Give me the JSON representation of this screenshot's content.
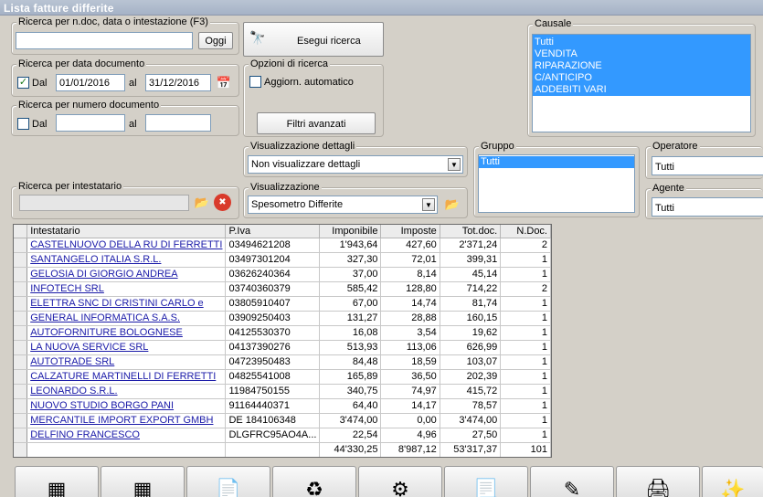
{
  "window": {
    "title": "Lista fatture differite"
  },
  "search_text": {
    "legend": "Ricerca per n.doc, data o intestazione (F3)",
    "value": "",
    "today_button": "Oggi"
  },
  "execute": {
    "label": "Esegui ricerca"
  },
  "date_search": {
    "legend": "Ricerca per data documento",
    "checked": true,
    "from_label": "Dal",
    "from_value": "01/01/2016",
    "to_label": "al",
    "to_value": "31/12/2016"
  },
  "search_options": {
    "legend": "Opzioni di ricerca",
    "auto_update_label": "Aggiorn. automatico",
    "auto_update_checked": false,
    "advanced_filters": "Filtri avanzati"
  },
  "number_search": {
    "legend": "Ricerca per numero documento",
    "checked": false,
    "from_label": "Dal",
    "from_value": "",
    "to_label": "al",
    "to_value": ""
  },
  "causale": {
    "legend": "Causale",
    "items": [
      "Tutti",
      "VENDITA",
      "RIPARAZIONE",
      "C/ANTICIPO",
      "ADDEBITI VARI"
    ]
  },
  "details_view": {
    "legend": "Visualizzazione dettagli",
    "selected": "Non visualizzare dettagli"
  },
  "gruppo": {
    "legend": "Gruppo",
    "items": [
      "Tutti"
    ]
  },
  "operatore": {
    "legend": "Operatore",
    "selected": "Tutti"
  },
  "intestatario_search": {
    "legend": "Ricerca per intestatario",
    "value": ""
  },
  "visualizzazione": {
    "legend": "Visualizzazione",
    "selected": "Spesometro Differite"
  },
  "agente": {
    "legend": "Agente",
    "selected": "Tutti"
  },
  "table": {
    "columns": [
      "Intestatario",
      "P.Iva",
      "Imponibile",
      "Imposte",
      "Tot.doc.",
      "N.Doc."
    ],
    "rows": [
      {
        "name": "CASTELNUOVO DELLA RU DI FERRETTI",
        "piva": "03494621208",
        "imponibile": "1'943,64",
        "imposte": "427,60",
        "tot": "2'371,24",
        "ndoc": "2"
      },
      {
        "name": "SANTANGELO ITALIA S.R.L.",
        "piva": "03497301204",
        "imponibile": "327,30",
        "imposte": "72,01",
        "tot": "399,31",
        "ndoc": "1"
      },
      {
        "name": "GELOSIA DI GIORGIO ANDREA",
        "piva": "03626240364",
        "imponibile": "37,00",
        "imposte": "8,14",
        "tot": "45,14",
        "ndoc": "1"
      },
      {
        "name": "INFOTECH SRL",
        "piva": "03740360379",
        "imponibile": "585,42",
        "imposte": "128,80",
        "tot": "714,22",
        "ndoc": "2"
      },
      {
        "name": "ELETTRA SNC DI CRISTINI CARLO e",
        "piva": "03805910407",
        "imponibile": "67,00",
        "imposte": "14,74",
        "tot": "81,74",
        "ndoc": "1"
      },
      {
        "name": "GENERAL INFORMATICA S.A.S.",
        "piva": "03909250403",
        "imponibile": "131,27",
        "imposte": "28,88",
        "tot": "160,15",
        "ndoc": "1"
      },
      {
        "name": "AUTOFORNITURE BOLOGNESE",
        "piva": "04125530370",
        "imponibile": "16,08",
        "imposte": "3,54",
        "tot": "19,62",
        "ndoc": "1"
      },
      {
        "name": "LA NUOVA SERVICE SRL",
        "piva": "04137390276",
        "imponibile": "513,93",
        "imposte": "113,06",
        "tot": "626,99",
        "ndoc": "1"
      },
      {
        "name": "AUTOTRADE SRL",
        "piva": "04723950483",
        "imponibile": "84,48",
        "imposte": "18,59",
        "tot": "103,07",
        "ndoc": "1"
      },
      {
        "name": "CALZATURE MARTINELLI DI FERRETTI",
        "piva": "04825541008",
        "imponibile": "165,89",
        "imposte": "36,50",
        "tot": "202,39",
        "ndoc": "1"
      },
      {
        "name": "LEONARDO S.R.L.",
        "piva": "11984750155",
        "imponibile": "340,75",
        "imposte": "74,97",
        "tot": "415,72",
        "ndoc": "1"
      },
      {
        "name": "NUOVO STUDIO BORGO PANI",
        "piva": "91164440371",
        "imponibile": "64,40",
        "imposte": "14,17",
        "tot": "78,57",
        "ndoc": "1"
      },
      {
        "name": "MERCANTILE IMPORT EXPORT GMBH",
        "piva": "DE 184106348",
        "imponibile": "3'474,00",
        "imposte": "0,00",
        "tot": "3'474,00",
        "ndoc": "1"
      },
      {
        "name": "DELFINO FRANCESCO",
        "piva": "DLGFRC95AO4A...",
        "imponibile": "22,54",
        "imposte": "4,96",
        "tot": "27,50",
        "ndoc": "1"
      }
    ],
    "totals": {
      "imponibile": "44'330,25",
      "imposte": "8'987,12",
      "tot": "53'317,37",
      "ndoc": "101"
    }
  },
  "icons": {
    "binoculars": "🔭",
    "folder": "📂",
    "clear": "✖",
    "calendar": "📅",
    "toolbar": [
      "▦",
      "▦",
      "📄",
      "♻",
      "⚙",
      "📃",
      "✎",
      "🖨",
      "✨"
    ]
  }
}
